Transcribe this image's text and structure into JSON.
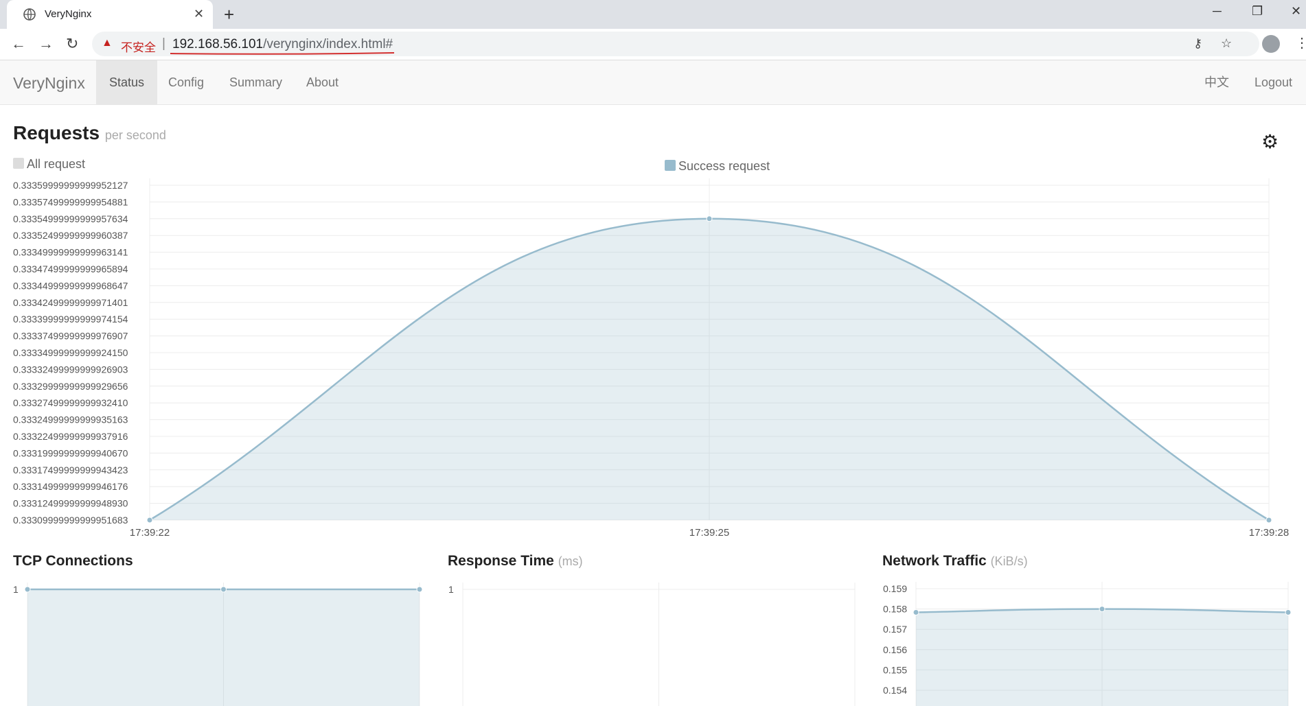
{
  "browser": {
    "tab_title": "VeryNginx",
    "insecure_label": "不安全",
    "url_host": "192.168.56.101",
    "url_path": "/verynginx/index.html#",
    "colors": {
      "insecure": "#c5221f",
      "underline": "#d32f2f"
    }
  },
  "navbar": {
    "brand": "VeryNginx",
    "links": [
      {
        "label": "Status",
        "active": true
      },
      {
        "label": "Config",
        "active": false
      },
      {
        "label": "Summary",
        "active": false
      },
      {
        "label": "About",
        "active": false
      }
    ],
    "lang": "中文",
    "logout": "Logout"
  },
  "requests": {
    "title": "Requests",
    "subtitle": "per second",
    "legend_all": "All request",
    "legend_success": "Success request"
  },
  "tcp": {
    "title": "TCP Connections"
  },
  "response": {
    "title": "Response Time",
    "unit": "(ms)"
  },
  "traffic": {
    "title": "Network Traffic",
    "unit": "(KiB/s)"
  },
  "chart_data": [
    {
      "type": "area",
      "title": "Requests per second",
      "series": [
        {
          "name": "Success request",
          "values": [
            0.3331,
            0.33355,
            0.3331
          ]
        }
      ],
      "x": [
        "17:39:22",
        "17:39:25",
        "17:39:28"
      ],
      "ylim": [
        0.3330999999999995,
        0.3335999999999995
      ],
      "yticks": [
        "0.33359999999999952127",
        "0.33357499999999954881",
        "0.33354999999999957634",
        "0.33352499999999960387",
        "0.33349999999999963141",
        "0.33347499999999965894",
        "0.33344999999999968647",
        "0.33342499999999971401",
        "0.33339999999999974154",
        "0.33337499999999976907",
        "0.33334999999999924150",
        "0.33332499999999926903",
        "0.33329999999999929656",
        "0.33327499999999932410",
        "0.33324999999999935163",
        "0.33322499999999937916",
        "0.33319999999999940670",
        "0.33317499999999943423",
        "0.33314999999999946176",
        "0.33312499999999948930",
        "0.33309999999999951683"
      ],
      "color": "#97bbcd",
      "grid": true
    },
    {
      "type": "area",
      "title": "TCP Connections",
      "series": [
        {
          "values": [
            1,
            1,
            1
          ]
        }
      ],
      "yticks": [
        "1"
      ],
      "color": "#97bbcd"
    },
    {
      "type": "line",
      "title": "Response Time (ms)",
      "series": [
        {
          "values": []
        }
      ],
      "yticks": [
        "1"
      ],
      "color": "#97bbcd"
    },
    {
      "type": "area",
      "title": "Network Traffic (KiB/s)",
      "series": [
        {
          "values": [
            0.1581,
            0.1583,
            0.1581
          ]
        }
      ],
      "ylim": [
        0.1535,
        0.1595
      ],
      "yticks": [
        "0.159",
        "0.158",
        "0.157",
        "0.156",
        "0.155",
        "0.154"
      ],
      "color": "#97bbcd"
    }
  ]
}
